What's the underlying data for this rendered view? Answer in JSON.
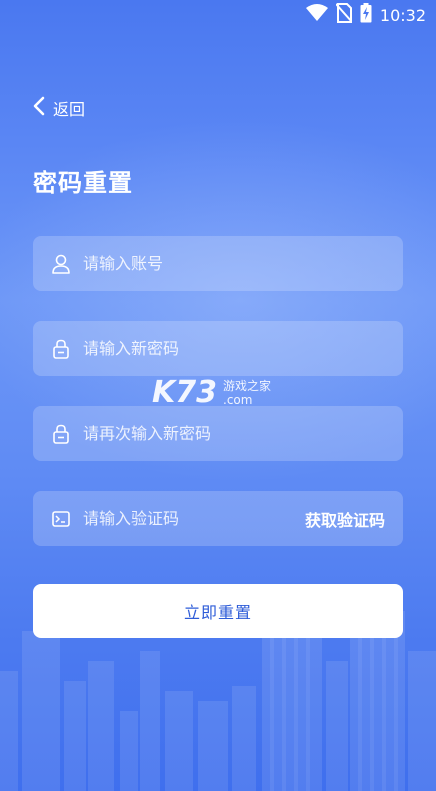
{
  "status_bar": {
    "time": "10:32",
    "icons": [
      "wifi-icon",
      "no-sim-icon",
      "battery-charging-icon"
    ]
  },
  "header": {
    "back_label": "返回",
    "title": "密码重置"
  },
  "form": {
    "account": {
      "placeholder": "请输入账号",
      "icon": "user-icon"
    },
    "new_password": {
      "placeholder": "请输入新密码",
      "icon": "lock-icon"
    },
    "confirm_password": {
      "placeholder": "请再次输入新密码",
      "icon": "lock-icon"
    },
    "code": {
      "placeholder": "请输入验证码",
      "icon": "terminal-icon",
      "get_code_label": "获取验证码"
    },
    "submit_label": "立即重置"
  },
  "watermark": {
    "logo": "K73",
    "line1": "游戏之家",
    "line2": ".com"
  },
  "colors": {
    "background_top": "#4a78f0",
    "background_bottom": "#3f6fee",
    "button_text": "#2e5cd8"
  }
}
